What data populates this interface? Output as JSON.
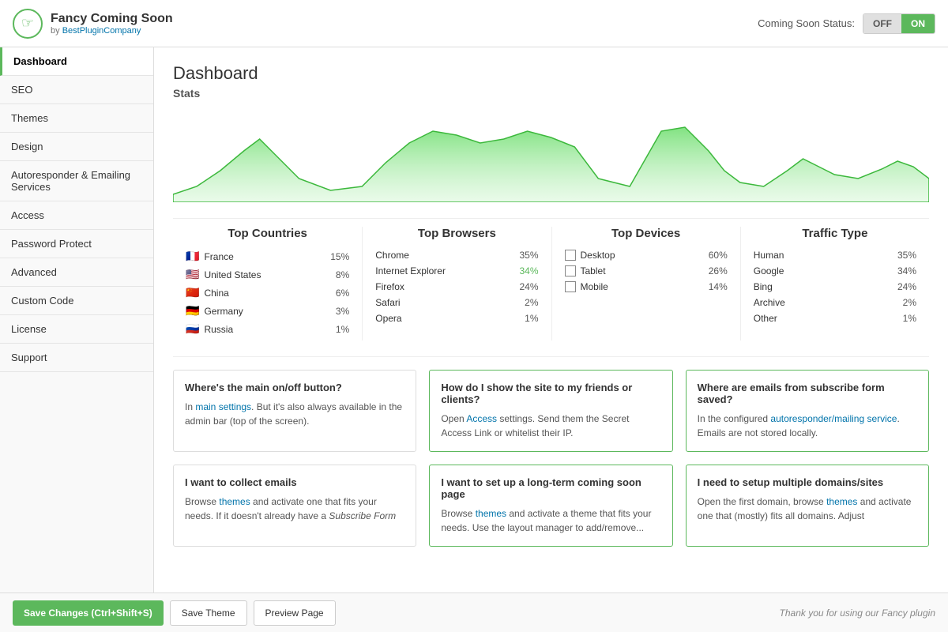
{
  "header": {
    "logo_icon": "☞",
    "app_title": "Fancy Coming Soon",
    "app_subtitle": "by",
    "app_subtitle_link": "BestPluginCompany",
    "status_label": "Coming Soon Status:",
    "toggle_off": "OFF",
    "toggle_on": "ON"
  },
  "sidebar": {
    "items": [
      {
        "label": "Dashboard",
        "active": true
      },
      {
        "label": "SEO",
        "active": false
      },
      {
        "label": "Themes",
        "active": false
      },
      {
        "label": "Design",
        "active": false
      },
      {
        "label": "Autoresponder & Emailing Services",
        "active": false
      },
      {
        "label": "Access",
        "active": false
      },
      {
        "label": "Password Protect",
        "active": false
      },
      {
        "label": "Advanced",
        "active": false
      },
      {
        "label": "Custom Code",
        "active": false
      },
      {
        "label": "License",
        "active": false
      },
      {
        "label": "Support",
        "active": false
      }
    ]
  },
  "main": {
    "page_title": "Dashboard",
    "stats_label": "Stats",
    "top_countries": {
      "title": "Top Countries",
      "rows": [
        {
          "flag": "🇫🇷",
          "name": "France",
          "pct": "15%",
          "green": false
        },
        {
          "flag": "🇺🇸",
          "name": "United States",
          "pct": "8%",
          "green": false
        },
        {
          "flag": "🇨🇳",
          "name": "China",
          "pct": "6%",
          "green": false
        },
        {
          "flag": "🇩🇪",
          "name": "Germany",
          "pct": "3%",
          "green": false
        },
        {
          "flag": "🇷🇺",
          "name": "Russia",
          "pct": "1%",
          "green": false
        }
      ]
    },
    "top_browsers": {
      "title": "Top Browsers",
      "rows": [
        {
          "name": "Chrome",
          "pct": "35%",
          "green": false
        },
        {
          "name": "Internet Explorer",
          "pct": "34%",
          "green": true
        },
        {
          "name": "Firefox",
          "pct": "24%",
          "green": false
        },
        {
          "name": "Safari",
          "pct": "2%",
          "green": false
        },
        {
          "name": "Opera",
          "pct": "1%",
          "green": false
        }
      ]
    },
    "top_devices": {
      "title": "Top Devices",
      "rows": [
        {
          "name": "Desktop",
          "pct": "60%",
          "green": false
        },
        {
          "name": "Tablet",
          "pct": "26%",
          "green": false
        },
        {
          "name": "Mobile",
          "pct": "14%",
          "green": false
        }
      ]
    },
    "traffic_type": {
      "title": "Traffic Type",
      "rows": [
        {
          "name": "Human",
          "pct": "35%",
          "green": false
        },
        {
          "name": "Google",
          "pct": "34%",
          "green": false
        },
        {
          "name": "Bing",
          "pct": "24%",
          "green": false
        },
        {
          "name": "Archive",
          "pct": "2%",
          "green": false
        },
        {
          "name": "Other",
          "pct": "1%",
          "green": false
        }
      ]
    },
    "cards": [
      {
        "title": "Where's the main on/off button?",
        "body": "In {main settings}. But it's also always available in the admin bar (top of the screen).",
        "link_text": "main settings",
        "link_href": "#",
        "green": false
      },
      {
        "title": "How do I show the site to my friends or clients?",
        "body": "Open {Access} settings. Send them the Secret Access Link or whitelist their IP.",
        "link_text": "Access",
        "link_href": "#",
        "green": true
      },
      {
        "title": "Where are emails from subscribe form saved?",
        "body": "In the configured {autoresponder/mailing service}. Emails are not stored locally.",
        "link_text": "autoresponder/mailing service",
        "link_href": "#",
        "green": true
      },
      {
        "title": "I want to collect emails",
        "body": "Browse {themes} and activate one that fits your needs. If it doesn't already have a Subscribe Form",
        "link_text": "themes",
        "link_href": "#",
        "green": false
      },
      {
        "title": "I want to set up a long-term coming soon page",
        "body": "Browse {themes} and activate a theme that fits your needs. Use the layout manager to add/remove...",
        "link_text": "themes",
        "link_href": "#",
        "green": true
      },
      {
        "title": "I need to setup multiple domains/sites",
        "body": "Open the first domain, browse {themes} and activate one that (mostly) fits all domains. Adjust",
        "link_text": "themes",
        "link_href": "#",
        "green": true
      }
    ]
  },
  "footer": {
    "save_changes_label": "Save Changes (Ctrl+Shift+S)",
    "save_theme_label": "Save Theme",
    "preview_page_label": "Preview Page",
    "thanks_text": "Thank you for using our Fancy plugin"
  }
}
